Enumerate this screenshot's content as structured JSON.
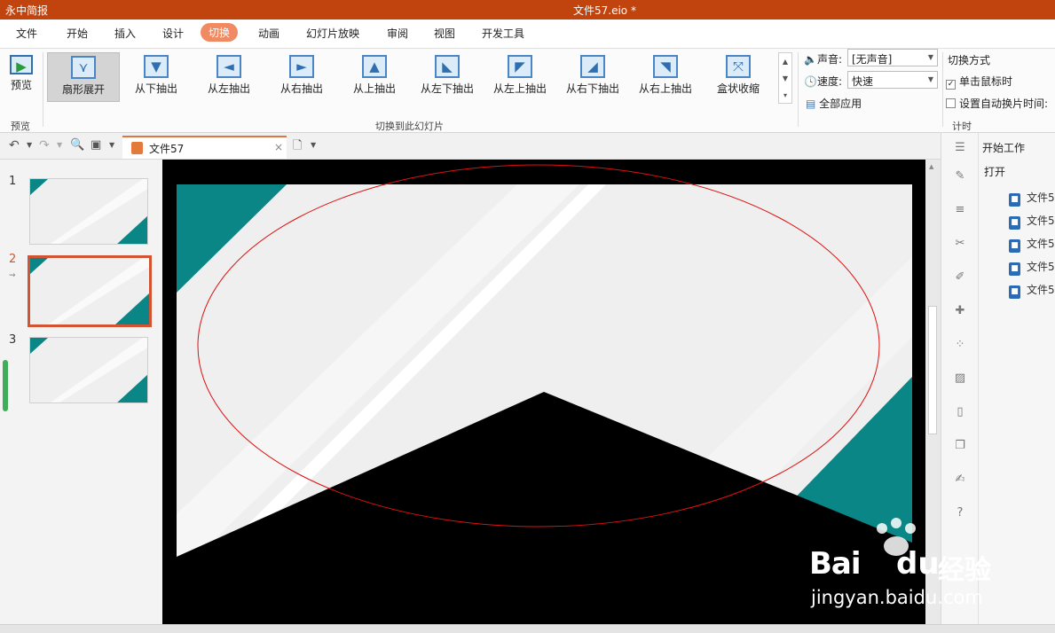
{
  "titlebar": {
    "app_name": "永中简报",
    "doc_title": "文件57.eio *"
  },
  "menu": {
    "file": "文件",
    "home": "开始",
    "insert": "插入",
    "design": "设计",
    "transition": "切换",
    "animation": "动画",
    "slideshow": "幻灯片放映",
    "review": "审阅",
    "view": "视图",
    "devtools": "开发工具"
  },
  "ribbon": {
    "preview_label": "预览",
    "preview_group": "预览",
    "effects": [
      {
        "label": "扇形展开",
        "glyph": "⋎"
      },
      {
        "label": "从下抽出",
        "glyph": "▼"
      },
      {
        "label": "从左抽出",
        "glyph": "◄"
      },
      {
        "label": "从右抽出",
        "glyph": "►"
      },
      {
        "label": "从上抽出",
        "glyph": "▲"
      },
      {
        "label": "从左下抽出",
        "glyph": "◣"
      },
      {
        "label": "从左上抽出",
        "glyph": "◤"
      },
      {
        "label": "从右下抽出",
        "glyph": "◢"
      },
      {
        "label": "从右上抽出",
        "glyph": "◥"
      },
      {
        "label": "盒状收缩",
        "glyph": "⤧"
      }
    ],
    "effects_group": "切换到此幻灯片",
    "sound_label": "声音:",
    "sound_value": "[无声音]",
    "speed_label": "速度:",
    "speed_value": "快速",
    "apply_all": "全部应用",
    "switch_mode": "切换方式",
    "on_click": "单击鼠标时",
    "auto_time": "设置自动换片时间:",
    "timing_group": "计时"
  },
  "quickaccess": {
    "tab_title": "文件57"
  },
  "slides": [
    {
      "num": "1"
    },
    {
      "num": "2"
    },
    {
      "num": "3"
    }
  ],
  "rightpane": {
    "start_work": "开始工作",
    "open": "打开",
    "files": [
      "文件5",
      "文件5",
      "文件5",
      "文件5",
      "文件5"
    ]
  },
  "watermark": {
    "brand_a": "Bai",
    "brand_b": "du",
    "brand_cn": "经验",
    "url": "jingyan.baidu.com"
  },
  "colors": {
    "accent": "#c1440e",
    "teal": "#0a8686",
    "tab_active": "#f08a62",
    "selection": "#d35433"
  }
}
